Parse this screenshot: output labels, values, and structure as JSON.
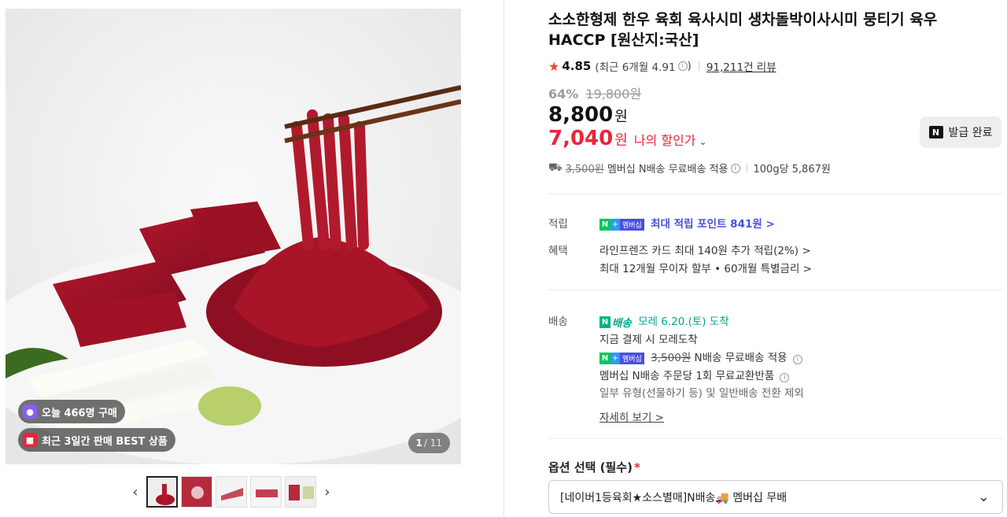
{
  "gallery": {
    "badges": [
      {
        "icon": "shopping-bag-icon",
        "label": "오늘 466명 구매"
      },
      {
        "icon": "gift-icon",
        "label": "최근 3일간 판매 BEST 상품"
      }
    ],
    "counter": {
      "current": "1",
      "total": "/ 11"
    },
    "thumbnails": [
      "raw-beef-chopsticks",
      "meat-package",
      "sliced-beef",
      "beef-slices-plate",
      "sashimi-set"
    ]
  },
  "product": {
    "title": "소소한형제 한우 육회 육사시미 생차돌박이사시미 뭉티기 육우 HACCP [원산지:국산]",
    "rating": "4.85",
    "recent_rating": "(최근 6개월 4.91",
    "recent_rating_close": ")",
    "reviews": "91,211건 리뷰",
    "discount_pct": "64%",
    "original_price": "19,800원",
    "price": "8,800",
    "price_unit": "원",
    "my_price": "7,040",
    "my_price_unit": "원",
    "my_price_label": "나의 할인가",
    "issued_button": "발급 완료",
    "ship_fee": "3,500원",
    "ship_text": "멤버십 N배송 무료배송 적용",
    "unit_price": "100g당 5,867원"
  },
  "benefits": {
    "points_key": "적립",
    "points_value": "최대 적립 포인트 841원 >",
    "membership_badge": "멤버십",
    "benefit_key": "혜택",
    "card": "라인프렌즈 카드 최대 140원 추가 적립(2%) >",
    "installment": "최대 12개월 무이자 할부 • 60개월 특별금리 >"
  },
  "delivery": {
    "key": "배송",
    "badge": "배송",
    "arrival": "모레 6.20.(토) 도착",
    "pay_note": "지금 결제 시 모레도착",
    "membership_fee": "3,500원",
    "membership_free": "N배송 무료배송 적용",
    "return_note": "멤버십 N배송 주문당 1회 무료교환반품",
    "exclusion": "일부 유형(선물하기 등) 및 일반배송 전환 제외",
    "details_link": "자세히 보기 >"
  },
  "options": {
    "label": "옵션 선택 (필수)",
    "required_mark": "*",
    "selected": "[네이버1등육회★소스별매]N배송🚚 멤버십 무배"
  },
  "colors": {
    "accent_red": "#e8263b",
    "membership_purple": "#4b4fdd",
    "delivery_green": "#00a58a",
    "naver_green": "#03c75a"
  }
}
